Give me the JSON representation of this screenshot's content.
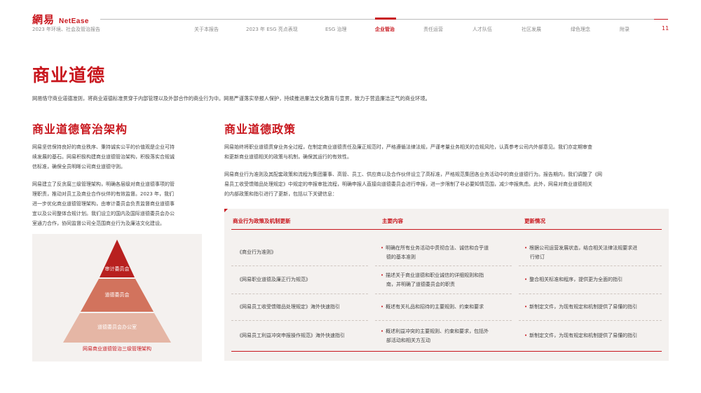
{
  "header": {
    "logo_cn": "網易",
    "logo_en": "NetEase",
    "report_subtitle": "2023 年环境、社会及管治报告",
    "nav": [
      {
        "label": "关于本报告",
        "active": false
      },
      {
        "label": "2023 年 ESG 亮点表现",
        "active": false
      },
      {
        "label": "ESG 治理",
        "active": false
      },
      {
        "label": "企业管治",
        "active": true
      },
      {
        "label": "责任运营",
        "active": false
      },
      {
        "label": "人才队伍",
        "active": false
      },
      {
        "label": "社区发展",
        "active": false
      },
      {
        "label": "绿色理念",
        "active": false
      },
      {
        "label": "附录",
        "active": false
      }
    ],
    "page_number": "11"
  },
  "main": {
    "title": "商业道德",
    "intro": "网易恪守商业道德准则，将商业道德标准贯穿于内部管理以及外部合作的商业行为中。网易严谨落实举报人保护，持续推进廉洁文化教育与宣贯，致力于营造廉洁正气的商业环境。"
  },
  "left": {
    "title": "商业道德管治架构",
    "para1_lines": [
      "网易坚信保持良好的商业秩序、秉持诚实公平的价值观是企业可持",
      "续发展的基石。网易积极构建商业道德管治架构，积极落实合规诚",
      "信标准，确保全员明晰公司商业道德守则。"
    ],
    "para2_lines": [
      "网易建立了反贪腐三级管理架构，明确各层级对商业道德事项的管",
      "理职责，推动对员工及商业合作伙伴的有效监督。2023 年，我们",
      "进一步优化商业道德管理架构，由审计委员会负责监督商业道德事",
      "宜以及公司整体合规计划。我们设立的国内及国际道德委员会办公",
      "室通力合作，协同监督公司全范围商业行为及廉洁文化建设。"
    ],
    "pyramid": {
      "levels": [
        "审计委员会",
        "道德委员会",
        "道德委员会办公室"
      ],
      "caption": "网易商业道德管治三级管理架构"
    }
  },
  "right": {
    "title": "商业道德政策",
    "para1_lines": [
      "网易始终将职业道德贯穿业务全过程，在制定商业道德责任及廉正规范时，严格遵循法律法规，严谨考量业务相关的合规风险，认真参考公司内外部意见。我们亦定期审查",
      "和更新商业道德相关的政策与机制，确保其运行的有效性。"
    ],
    "para2_lines": [
      "网易商业行为准则及其配套政策和流程为集团董事、高管、员工、供应商以及合作伙伴设立了高标准，严格规范集团各业务活动中的商业道德行为。报告期内，我们调整了《网",
      "易员工收受馈赠品处理规定》中规定的申报审批流程，明确申报人直接向道德委员会进行申报，进一步限制了非必要知情范围，减少申报焦虑。此外，网易对商业道德相关",
      "的内部政策和指引进行了更新，包括以下关键信息："
    ],
    "table": {
      "headers": [
        "商业行为政策及机制更新",
        "主要内容",
        "更新情况"
      ],
      "rows": [
        {
          "policy": "《商业行为准则》",
          "content": [
            "明确在所有业务活动中贯彻合法、诚信和合乎道",
            "德的基本准则"
          ],
          "status": [
            "根据公司运营发展状态，结合相关法律法规要求进",
            "行修订"
          ]
        },
        {
          "policy": "《网易职业道德及廉正行为规范》",
          "content": [
            "描述关于商业道德和职业诚信的详细规则和指",
            "南，并明确了道德委员会的职责"
          ],
          "status": [
            "整合相关标准和程序，提供更为全面的指引"
          ]
        },
        {
          "policy": "《网易员工收受馈赠品处理规定》海外快速指引",
          "content": [
            "概述有关礼品和招待的主要规则、约束和要求"
          ],
          "status": [
            "新制定文件，为现有规定和机制提供了易懂的指引"
          ]
        },
        {
          "policy": "《网易员工利益冲突申报操作规范》海外快速指引",
          "content": [
            "概述利益冲突的主要规则、约束和要求，包括外",
            "部活动和相关方互动"
          ],
          "status": [
            "新制定文件，为现有规定和机制提供了易懂的指引"
          ]
        }
      ]
    }
  },
  "colors": {
    "brand_red": "#c8161d",
    "pyramid_top": "#b8201f",
    "pyramid_mid": "#d2735d",
    "pyramid_bottom": "#e5b6a5",
    "panel_bg": "#f4f1ef"
  }
}
